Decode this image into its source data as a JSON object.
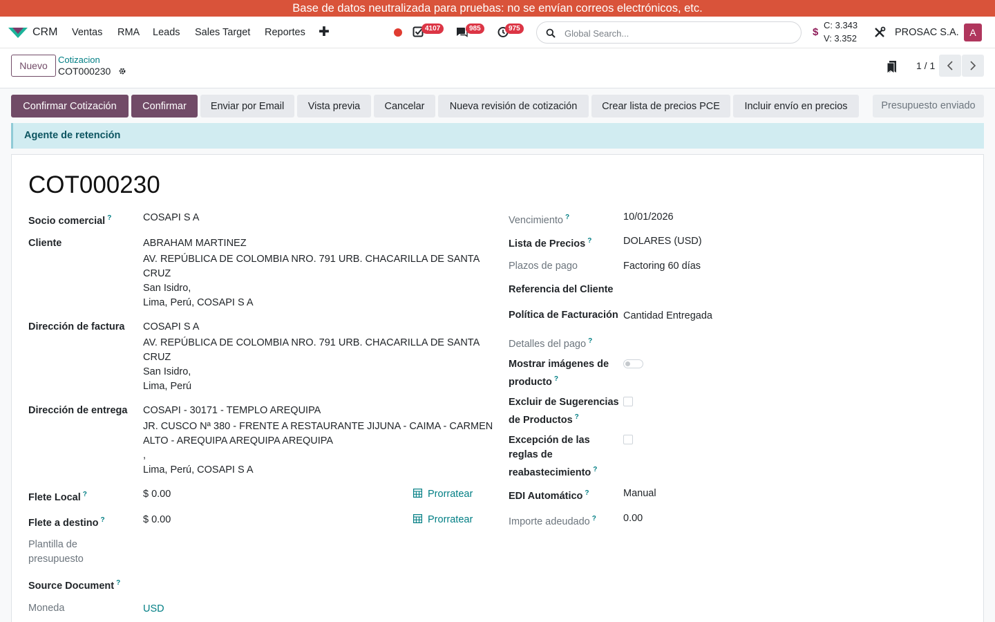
{
  "banner": {
    "text": "Base de datos neutralizada para pruebas: no se envían correos electrónicos, etc."
  },
  "navbar": {
    "app_name": "CRM",
    "menu": [
      "Ventas",
      "RMA",
      "Leads",
      "Sales Target",
      "Reportes"
    ],
    "badges": {
      "activities": "4107",
      "messages": "985",
      "timers": "975"
    },
    "search_placeholder": "Global Search...",
    "currency_symbol": "$",
    "rate_buy": "C: 3.343",
    "rate_sell": "V: 3.352",
    "company": "PROSAC S.A.",
    "avatar_letter": "A"
  },
  "control": {
    "new_label": "Nuevo",
    "breadcrumb_parent": "Cotizacion",
    "breadcrumb_current": "COT000230",
    "pager": "1 / 1"
  },
  "actions": {
    "confirm_quote": "Confirmar Cotización",
    "confirm": "Confirmar",
    "send_email": "Enviar por Email",
    "preview": "Vista previa",
    "cancel": "Cancelar",
    "new_revision": "Nueva revisión de cotización",
    "pce_pricelist": "Crear lista de precios PCE",
    "include_shipping": "Incluir envío en precios",
    "status": "Presupuesto enviado"
  },
  "alert": {
    "text": "Agente de retención"
  },
  "form": {
    "title": "COT000230",
    "left": {
      "partner_label": "Socio comercial",
      "partner_value": "COSAPI S A",
      "client_label": "Cliente",
      "client_lines": [
        "ABRAHAM MARTINEZ",
        "AV. REPÚBLICA DE COLOMBIA NRO. 791 URB. CHACARILLA DE SANTA",
        "CRUZ",
        "San Isidro,",
        "Lima, Perú, COSAPI S A"
      ],
      "invoice_label": "Dirección de factura",
      "invoice_lines": [
        "COSAPI S A",
        "AV. REPÚBLICA DE COLOMBIA NRO. 791 URB. CHACARILLA DE SANTA",
        "CRUZ",
        "San Isidro,",
        "Lima, Perú"
      ],
      "delivery_label": "Dirección de entrega",
      "delivery_lines": [
        "COSAPI - 30171 - TEMPLO AREQUIPA",
        "JR. CUSCO Nª 380 - FRENTE A RESTAURANTE JIJUNA - CAIMA - CARMEN",
        "ALTO - AREQUIPA AREQUIPA AREQUIPA",
        ",",
        "Lima, Perú, COSAPI S A"
      ],
      "freight_local_label": "Flete Local",
      "freight_local_value": "$ 0.00",
      "freight_dest_label": "Flete a destino",
      "freight_dest_value": "$ 0.00",
      "prorate_label": "Prorratear",
      "template_label_1": "Plantilla de",
      "template_label_2": "presupuesto",
      "source_label": "Source Document",
      "currency_label": "Moneda",
      "currency_value": "USD"
    },
    "right": {
      "due_label": "Vencimiento",
      "due_value": "10/01/2026",
      "pricelist_label": "Lista de Precios",
      "pricelist_value": "DOLARES (USD)",
      "terms_label": "Plazos de pago",
      "terms_value": "Factoring 60 días",
      "ref_label": "Referencia del Cliente",
      "policy_label": "Política de Facturación",
      "policy_value": "Cantidad Entregada",
      "payment_details_label": "Detalles del pago",
      "show_images_label_1": "Mostrar imágenes de",
      "show_images_label_2": "producto",
      "show_images_value": false,
      "exclude_label_1": "Excluir de Sugerencias",
      "exclude_label_2": "de Productos",
      "exclude_value": false,
      "exception_label_1": "Excepción de las",
      "exception_label_2": "reglas de",
      "exception_label_3": "reabastecimiento",
      "exception_value": false,
      "edi_label": "EDI Automático",
      "edi_value": "Manual",
      "due_amount_label": "Importe adeudado",
      "due_amount_value": "0.00"
    }
  },
  "colors": {
    "brand": "#714b67",
    "link": "#017e84",
    "banner": "#d9533a",
    "badge": "#dc3545"
  }
}
